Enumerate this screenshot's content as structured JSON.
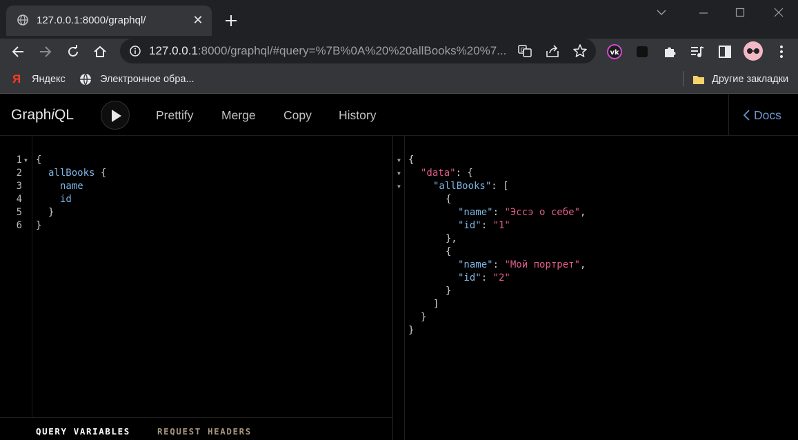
{
  "browser": {
    "tab": {
      "title": "127.0.0.1:8000/graphql/"
    },
    "url": {
      "host": "127.0.0.1",
      "rest": ":8000/graphql/#query=%7B%0A%20%20allBooks%20%7..."
    },
    "bookmarks": [
      {
        "label": "Яндекс"
      },
      {
        "label": "Электронное обра..."
      }
    ],
    "other_bookmarks": "Другие закладки"
  },
  "graphiql": {
    "logo_pre": "Graph",
    "logo_i": "i",
    "logo_post": "QL",
    "buttons": {
      "prettify": "Prettify",
      "merge": "Merge",
      "copy": "Copy",
      "history": "History"
    },
    "docs": "Docs",
    "query_lines": [
      {
        "num": "1",
        "text": "{"
      },
      {
        "num": "2",
        "field": "allBooks",
        "suffix": " {"
      },
      {
        "num": "3",
        "field": "name"
      },
      {
        "num": "4",
        "field": "id"
      },
      {
        "num": "5",
        "text": "}"
      },
      {
        "num": "6",
        "text": "}"
      }
    ],
    "bottom_tabs": {
      "variables": "QUERY VARIABLES",
      "headers": "REQUEST HEADERS"
    },
    "result": {
      "open": "{",
      "data_key": "\"data\"",
      "allbooks_key": "\"allBooks\"",
      "books": [
        {
          "name_key": "\"name\"",
          "name_val": "\"Эссэ о себе\"",
          "id_key": "\"id\"",
          "id_val": "\"1\""
        },
        {
          "name_key": "\"name\"",
          "name_val": "\"Мой портрет\"",
          "id_key": "\"id\"",
          "id_val": "\"2\""
        }
      ]
    }
  },
  "colors": {
    "field": "#7eb4e2",
    "string": "#e05d8e",
    "docs": "#6e94ce",
    "active_tab": "#ffffff",
    "inactive_tab": "#a6957c"
  }
}
